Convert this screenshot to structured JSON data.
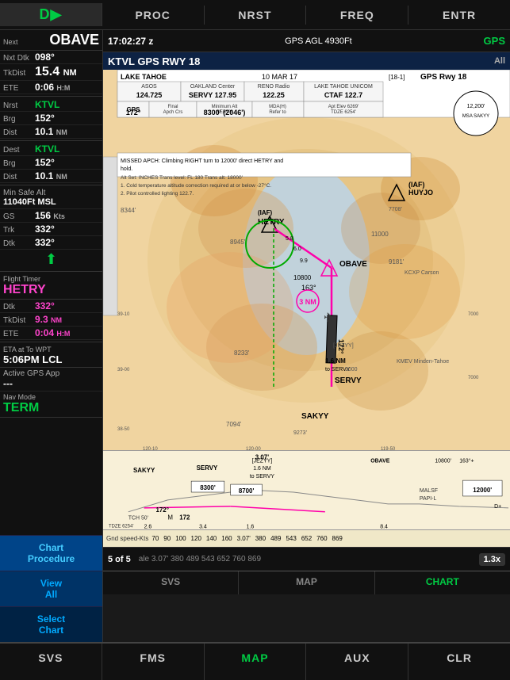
{
  "topNav": {
    "icon": "D▶",
    "items": [
      "Proc",
      "Nrst",
      "Freq",
      "Entr"
    ]
  },
  "infoPanel": {
    "next_label": "Next",
    "next_value": "OBAVE",
    "nxt_dtk_label": "Nxt Dtk",
    "nxt_dtk_value": "098°",
    "tkdist_label": "TkDist",
    "tkdist_value": "15.4",
    "tkdist_unit": "NM",
    "ete_label": "ETE",
    "ete_value": "0:06",
    "ete_unit": "H:M",
    "nrst_label": "Nrst",
    "nrst_value": "KTVL",
    "brg_label": "Brg",
    "brg_value": "152°",
    "dist_label": "Dist",
    "dist_value": "10.1",
    "dist_unit": "NM",
    "dest_label": "Dest",
    "dest_value": "KTVL",
    "dest_brg_label": "Brg",
    "dest_brg_value": "152°",
    "dest_dist_label": "Dist",
    "dest_dist_value": "10.1",
    "dest_dist_unit": "NM",
    "min_safe_alt_label": "Min Safe Alt",
    "min_safe_alt_value": "11040Ft MSL",
    "gs_label": "GS",
    "gs_value": "156",
    "gs_unit": "Kts",
    "trk_label": "Trk",
    "trk_value": "332°",
    "dtk_label": "Dtk",
    "dtk_value": "332°",
    "flight_timer_label": "Flight Timer",
    "flight_timer_name": "HETRY",
    "flight_timer_dtk_label": "Dtk",
    "flight_timer_dtk_value": "332°",
    "flight_timer_tkdist_label": "TkDist",
    "flight_timer_tkdist_value": "9.3",
    "flight_timer_tkdist_unit": "NM",
    "flight_timer_ete_label": "ETE",
    "flight_timer_ete_value": "0:04",
    "flight_timer_ete_unit": "H:M",
    "eta_label": "ETA at To WPT",
    "eta_value": "5:06PM LCL",
    "active_gps_label": "Active GPS App",
    "active_gps_value": "---",
    "nav_mode_label": "Nav Mode",
    "nav_mode_value": "TERM",
    "chart_btn1": "Chart\nProcedure",
    "chart_btn2": "View\nAll",
    "chart_btn3": "Select\nChart"
  },
  "chartHeader": {
    "time": "17:02:27 z",
    "agl": "GPS AGL 4930Ft",
    "gps": "GPS",
    "subtitle_left": "KTVL    GPS RWY 18",
    "subtitle_right": "All"
  },
  "chart": {
    "airport": "LAKE TAHOE",
    "date": "10 MAR 17",
    "chart_id": "18-1",
    "title": "GPS Rwy 18",
    "asos_freq": "124.725",
    "oakland_freq": "127.95",
    "reno_freq": "122.25",
    "unicom_freq": "122.7",
    "gps_label": "GPS",
    "final_apch_crs": "172°",
    "min_alt_servy": "8300'",
    "min_alt_2046": "(2046')",
    "mda_h": "MDA(H)\nRefer to\nMinimums",
    "apt_elev": "Apt Elev 6269'",
    "tdze": "TDZE 6254'",
    "missed_apch": "MISSED APCH: Climbing RIGHT turn to 12000' direct HETRY and hold.",
    "alt_set": "Alt Set: INCHES",
    "trans_level": "Trans level: FL 180",
    "trans_alt": "Trans alt: 18000'",
    "cold_temp": "1. Cold temperature altitude correction required at or below -27°C.",
    "pilot_lighting": "2. Pilot controlled lighting 122.7.",
    "waypoints": {
      "huyjo": "HUYJO",
      "hetry": "HETRY",
      "obave": "OBAVE",
      "servy": "SERVY",
      "sakyy": "SAKYY",
      "jezyy": "JEZYY"
    },
    "altitudes": {
      "obave": "10800",
      "final": "172°",
      "jezyy_dist": "1.6 NM",
      "jezyy_alt": "9000",
      "msa_sakyy": "MSA SAKYY",
      "msa_alt": "12,200'"
    },
    "profile_section": {
      "jezyy": "[JEZYY]",
      "obave": "OBAVE",
      "obave_alt": "10800'",
      "jezyy_dist": "1.6 NM to SERVY",
      "sakyy": "SAKYY",
      "servy": "SERVY",
      "servy_alt": "8700'",
      "servy_alt2": "8300'",
      "tch": "TCH 50'",
      "heading": "172°",
      "m_symbol": "M",
      "heading2": "172",
      "tdze2": "TDZE 6254'",
      "dist1": "2.6",
      "dist2": "3.07",
      "dist3": "3.4",
      "dist4": "1.6",
      "dist5": "8.4",
      "mals_f": "MALS F",
      "papi_l": "PAPI-L",
      "alt_12000": "12000'",
      "d_plus": "D+",
      "obave_heading": "163°+"
    },
    "speed_row": {
      "label": "Gnd speed-Kts",
      "speeds": [
        "70",
        "90",
        "100",
        "120",
        "140",
        "160"
      ],
      "times": [
        "3.07'",
        "380",
        "489",
        "543",
        "652",
        "760",
        "869"
      ]
    },
    "page": "5 of 5"
  },
  "bottomTabs": {
    "svs": "SVS",
    "map": "MAP",
    "chart": "CHART"
  },
  "bottomNav": {
    "svs": "SVS",
    "fms": "FMS",
    "map": "MAP",
    "aux": "AUX",
    "clr": "CLR"
  },
  "zoom": "1.3x"
}
